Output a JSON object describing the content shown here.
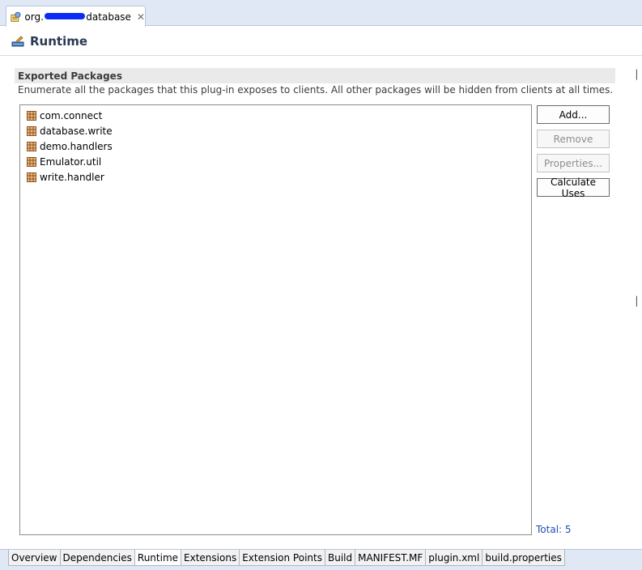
{
  "editor_tab": {
    "label_prefix": "org.",
    "label_suffix": "database",
    "icons": {
      "plugin": "plugin-manifest-icon",
      "close": "close-icon"
    }
  },
  "page": {
    "title": "Runtime",
    "icon": "runtime-icon"
  },
  "section": {
    "title": "Exported Packages",
    "description": "Enumerate all the packages that this plug-in exposes to clients.  All other packages will be hidden from clients at all times."
  },
  "packages": [
    {
      "name": "com.connect",
      "icon": "package-icon"
    },
    {
      "name": "database.write",
      "icon": "package-icon"
    },
    {
      "name": "demo.handlers",
      "icon": "package-icon"
    },
    {
      "name": "Emulator.util",
      "icon": "package-icon"
    },
    {
      "name": "write.handler",
      "icon": "package-icon"
    }
  ],
  "buttons": {
    "add": "Add...",
    "remove": "Remove",
    "properties": "Properties...",
    "calculate_uses": "Calculate Uses"
  },
  "total_label": "Total: 5",
  "bottom_tabs": [
    {
      "label": "Overview",
      "active": false
    },
    {
      "label": "Dependencies",
      "active": false
    },
    {
      "label": "Runtime",
      "active": true
    },
    {
      "label": "Extensions",
      "active": false
    },
    {
      "label": "Extension Points",
      "active": false
    },
    {
      "label": "Build",
      "active": false
    },
    {
      "label": "MANIFEST.MF",
      "active": false
    },
    {
      "label": "plugin.xml",
      "active": false
    },
    {
      "label": "build.properties",
      "active": false
    }
  ],
  "colors": {
    "tabstrip": "#dfe8f4",
    "title_text": "#2a3a52",
    "link_blue": "#1f4fb4",
    "section_band": "#eaeaea",
    "package_icon": "#b8753a"
  }
}
